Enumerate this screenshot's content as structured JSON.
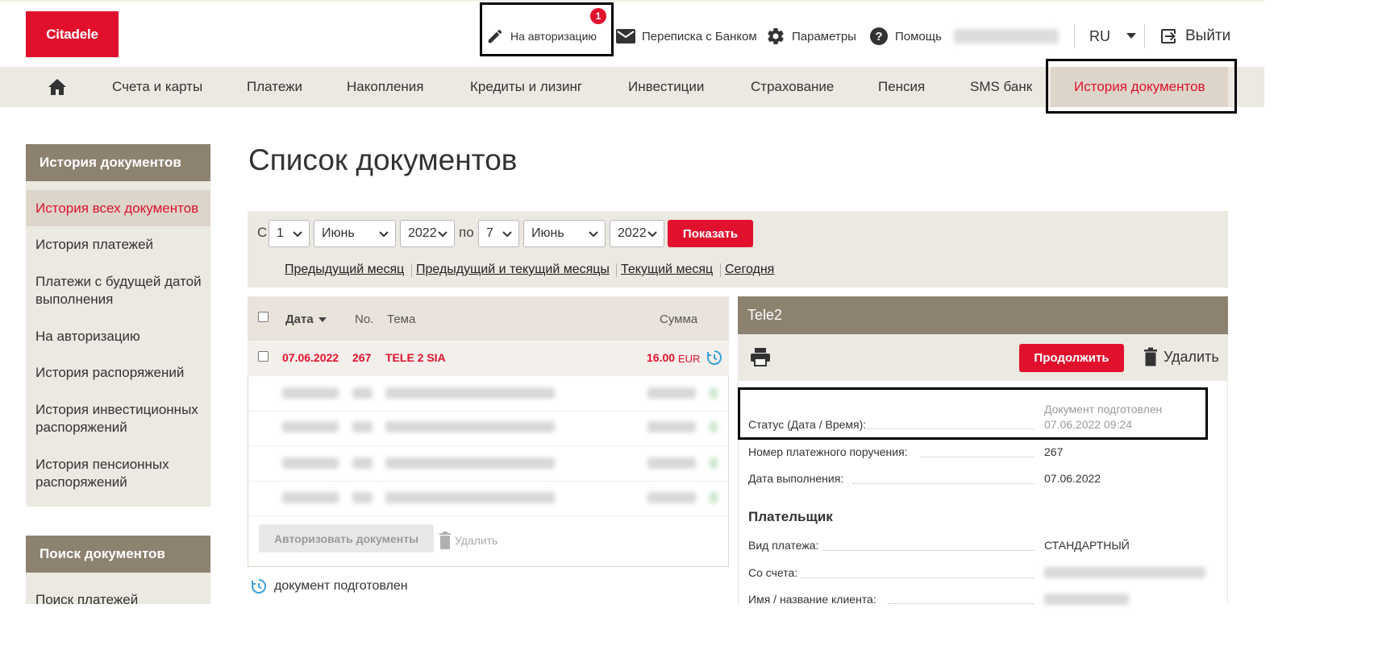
{
  "brand": {
    "logo_text": "Citadele",
    "accent": "#e1112d",
    "panel": "#8d8170"
  },
  "topbar": {
    "authorize_label": "На авторизацию",
    "authorize_count": "1",
    "messages_label": "Переписка с Банком",
    "settings_label": "Параметры",
    "help_label": "Помощь",
    "language": "RU",
    "logout_label": "Выйти"
  },
  "nav": {
    "items": [
      "Счета и карты",
      "Платежи",
      "Накопления",
      "Кредиты и лизинг",
      "Инвестиции",
      "Страхование",
      "Пенсия",
      "SMS банк",
      "История документов"
    ],
    "active": "История документов"
  },
  "sidebar": {
    "title": "История документов",
    "items": [
      "История всех документов",
      "История платежей",
      "Платежи с будущей датой выполнения",
      "На авторизацию",
      "История распоряжений",
      "История инвестиционных распоряжений",
      "История пенсионных распоряжений"
    ],
    "search_title": "Поиск документов",
    "search_items": [
      "Поиск платежей"
    ]
  },
  "page": {
    "title": "Список документов"
  },
  "filter": {
    "from_label": "С",
    "to_label": "по",
    "from_day": "1",
    "from_month": "Июнь",
    "from_year": "2022",
    "to_day": "7",
    "to_month": "Июнь",
    "to_year": "2022",
    "show_button": "Показать",
    "quick_links": [
      "Предыдущий месяц",
      "Предыдущий и текущий месяцы",
      "Текущий месяц",
      "Сегодня"
    ]
  },
  "table": {
    "headers": {
      "date": "Дата",
      "no": "No.",
      "subject": "Тема",
      "amount": "Сумма"
    },
    "rows": [
      {
        "date": "07.06.2022",
        "no": "267",
        "subject": "TELE 2 SIA",
        "amount": "16.00",
        "currency": "EUR"
      }
    ],
    "authorize_button": "Авторизовать документы",
    "delete_label": "Удалить",
    "legend": "документ подготовлен"
  },
  "details": {
    "title": "Tele2",
    "continue_button": "Продолжить",
    "delete_label": "Удалить",
    "status_label": "Статус (Дата / Время):",
    "status_text": "Документ подготовлен",
    "status_time": "07.06.2022 09:24",
    "order_no_label": "Номер платежного поручения:",
    "order_no": "267",
    "exec_date_label": "Дата выполнения:",
    "exec_date": "07.06.2022",
    "payer_title": "Плательщик",
    "payment_type_label": "Вид платежа:",
    "payment_type": "СТАНДАРТНЫЙ",
    "from_account_label": "Со счета:",
    "client_name_label": "Имя / название  клиента:"
  }
}
